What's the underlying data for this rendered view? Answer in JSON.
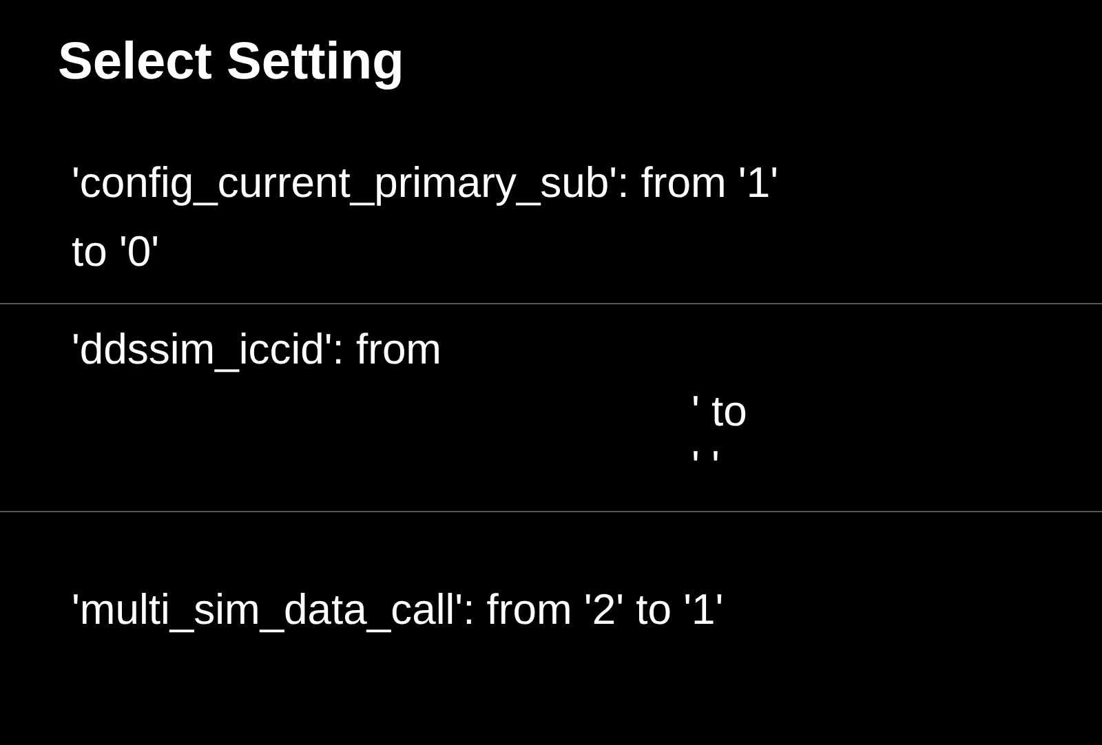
{
  "title": "Select Setting",
  "items": [
    {
      "lines": [
        {
          "kind": "plain",
          "text": "'config_current_primary_sub': from '1'"
        },
        {
          "kind": "plain",
          "text": "to '0'"
        }
      ]
    },
    {
      "lines": [
        {
          "kind": "plain",
          "text": "'ddssim_iccid': from"
        },
        {
          "kind": "after_redaction",
          "text": "' to"
        },
        {
          "kind": "after_redaction",
          "text": "' '"
        }
      ]
    },
    {
      "lines": [
        {
          "kind": "plain",
          "text": "'multi_sim_data_call': from '2' to '1'"
        }
      ]
    }
  ]
}
